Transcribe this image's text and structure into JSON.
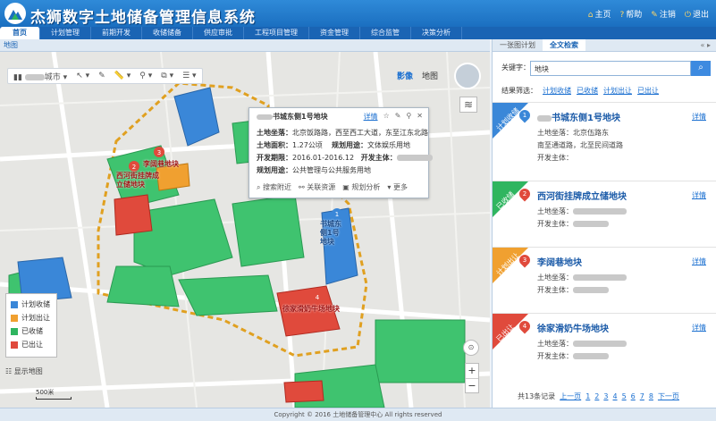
{
  "header": {
    "title": "杰狮数字土地储备管理信息系统",
    "links": [
      {
        "label": "主页",
        "icon": "home-icon"
      },
      {
        "label": "帮助",
        "icon": "help-icon"
      },
      {
        "label": "注销",
        "icon": "logout-icon"
      },
      {
        "label": "退出",
        "icon": "exit-icon"
      }
    ]
  },
  "nav": {
    "tabs": [
      "首页",
      "计划管理",
      "前期开发",
      "收储储备",
      "供应审批",
      "工程项目管理",
      "资金管理",
      "综合监管",
      "决策分析"
    ],
    "active": 0
  },
  "map": {
    "title": "地图",
    "toolbar": [
      "城市",
      "",
      "",
      "",
      "",
      "",
      ""
    ],
    "map_types": [
      "影像",
      "地图"
    ],
    "active_map_type": 0,
    "popup": {
      "title_suffix": "书城东侧1号地块",
      "detail": "详情",
      "rows": [
        {
          "label": "土地坐落：",
          "value": "北京饭路路，西至西工大道，东至江东北路"
        },
        {
          "label": "土地面积：",
          "value": "1.27公顷",
          "label2": "规划用途：",
          "value2": "文体娱乐用地"
        },
        {
          "label": "开发期限：",
          "value": "2016.01-2016.12",
          "label2": "开发主体：",
          "value2": ""
        },
        {
          "label": "规划用途：",
          "value": "公共管理与公共服务用地"
        }
      ],
      "actions": [
        "搜索附近",
        "关联资源",
        "规划分析",
        "更多"
      ]
    },
    "legend": [
      {
        "label": "计划收储",
        "color": "#3a87d8"
      },
      {
        "label": "计划出让",
        "color": "#f0a030"
      },
      {
        "label": "已收储",
        "color": "#2fb560"
      },
      {
        "label": "已出让",
        "color": "#e04a3c"
      }
    ],
    "parcel_labels": [
      "西河街挂牌成立储地块",
      "李阔巷地块",
      "书城东侧1号地块",
      "徐家滑奶牛场地块"
    ],
    "minimap_label": "显示地图",
    "scale": "500米"
  },
  "panel": {
    "tabs": [
      "一张图计划",
      "全文检索"
    ],
    "active_tab": 1,
    "controls": "« ▸",
    "keyword_label": "关键字：",
    "keyword_value": "地块",
    "filter_label": "结果筛选：",
    "filters": [
      "计划收储",
      "已收储",
      "计划出让",
      "已出让"
    ],
    "detail_label": "详情",
    "cards": [
      {
        "status": "计划收储",
        "color": "#3a87d8",
        "num": "1",
        "title": "书城东侧1号地块",
        "lines": [
          "土地坐落：北京伍路东",
          "南至通道路，北至民间道路",
          "开发主体："
        ]
      },
      {
        "status": "已收储",
        "color": "#2fb560",
        "num": "2",
        "title": "西河街挂牌成立储地块",
        "lines": [
          "土地坐落：",
          "开发主体："
        ]
      },
      {
        "status": "计划出让",
        "color": "#f0a030",
        "num": "3",
        "title": "李阔巷地块",
        "lines": [
          "土地坐落：",
          "开发主体："
        ]
      },
      {
        "status": "已出让",
        "color": "#e04a3c",
        "num": "4",
        "title": "徐家滑奶牛场地块",
        "lines": [
          "土地坐落：",
          "开发主体："
        ]
      }
    ],
    "pager": {
      "total": "共13条记录",
      "first": "上一页",
      "pages": [
        "1",
        "2",
        "3",
        "4",
        "5",
        "6",
        "7",
        "8"
      ],
      "next": "下一页"
    }
  },
  "footer": {
    "text": "Copyright © 2016 土地储备管理中心 All rights reserved"
  }
}
